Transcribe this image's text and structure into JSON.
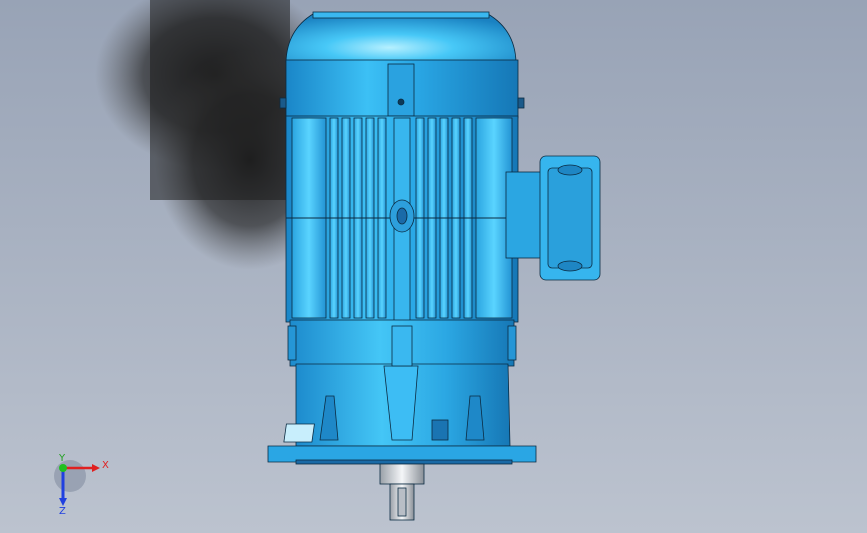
{
  "viewport": {
    "background_top": "#9aa5b8",
    "background_bottom": "#b9c1cd",
    "model_color": "#29a7e8",
    "model_highlight": "#6fd3ff",
    "model_shadow": "#1277b8",
    "edge_color": "#0a2a40"
  },
  "triad": {
    "x_label": "X",
    "y_label": "Y",
    "z_label": "Z",
    "x_color": "#e02020",
    "y_color": "#20c020",
    "z_color": "#2040e0"
  }
}
